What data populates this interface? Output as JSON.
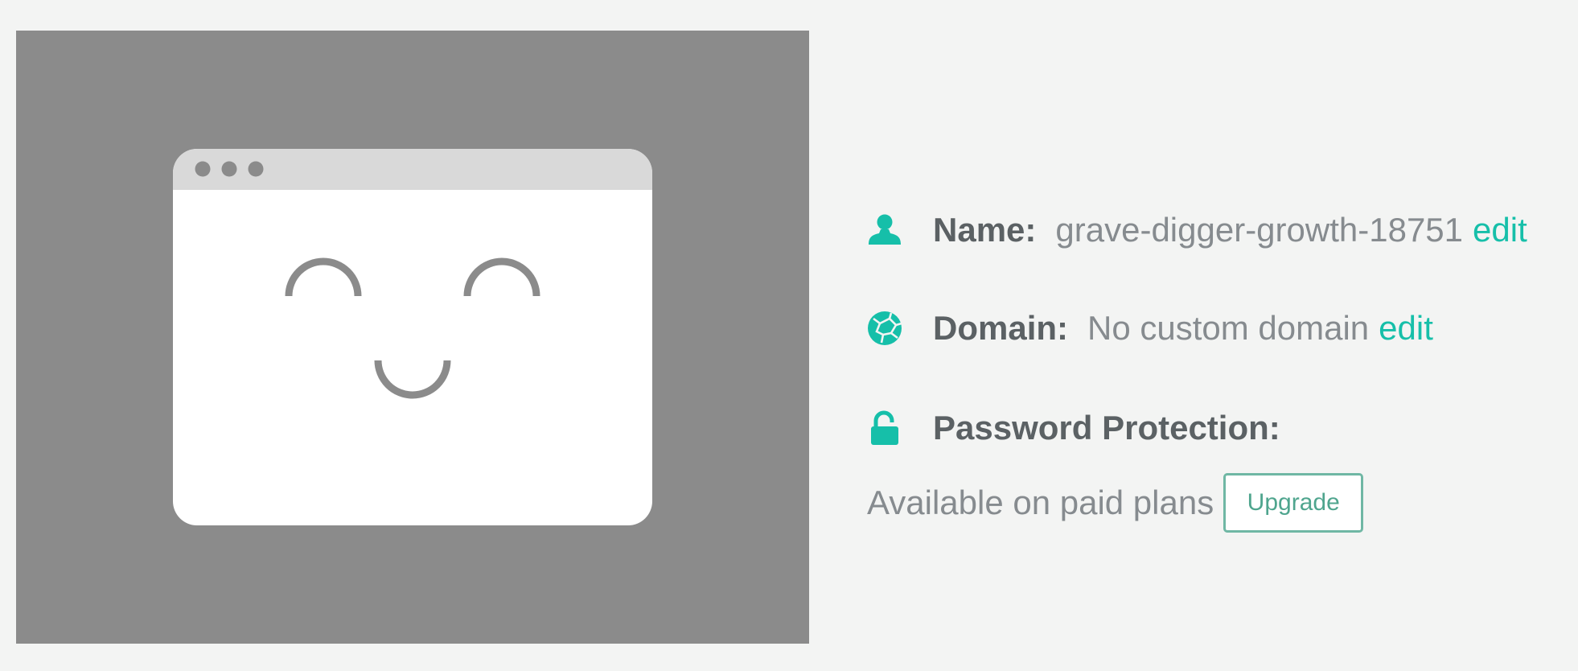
{
  "preview": {
    "illustration": "happy-browser-window",
    "bg_color": "#8b8b8b"
  },
  "site": {
    "name_label": "Name:",
    "name_value": "grave-digger-growth-18751",
    "name_edit": "edit",
    "domain_label": "Domain:",
    "domain_value": "No custom domain",
    "domain_edit": "edit",
    "password_label": "Password Protection:",
    "password_note": "Available on paid plans",
    "upgrade_label": "Upgrade"
  },
  "icons": {
    "name": "user-icon",
    "domain": "globe-icon",
    "password": "unlock-icon"
  },
  "colors": {
    "accent": "#16bfa9",
    "label": "#5b6164",
    "value": "#868b8f",
    "upgrade_border": "#6fb7a4"
  }
}
